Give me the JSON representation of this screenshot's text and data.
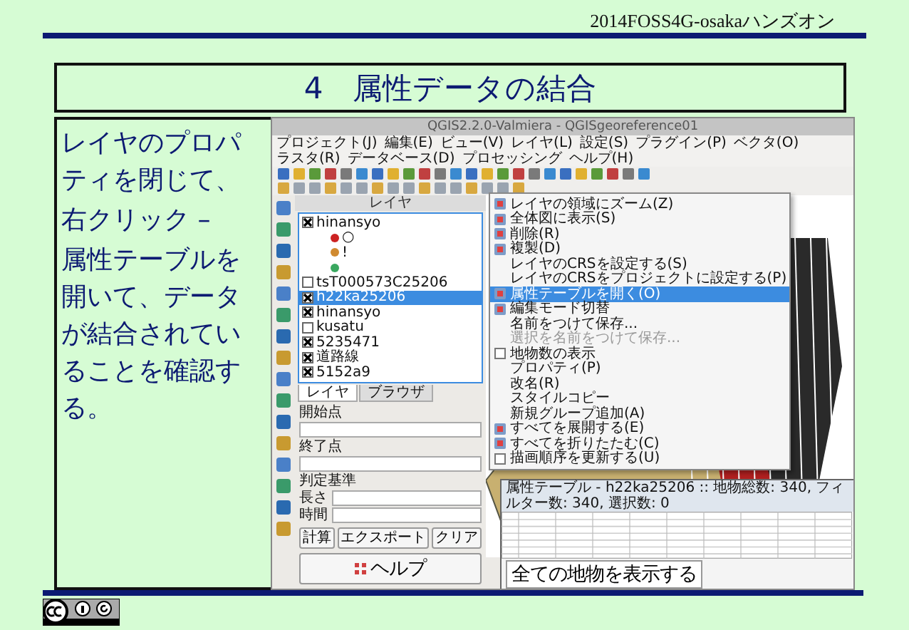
{
  "header": {
    "text": "2014FOSS4G-osakaハンズオン"
  },
  "slide_title": "4　属性データの結合",
  "note": {
    "paragraphs": [
      "レイヤのプロパティを閉じて、",
      "右クリック –",
      "属性テーブルを開いて、データが結合されていることを確認する。"
    ]
  },
  "qgis": {
    "window_title": "QGIS2.2.0-Valmiera - QGISgeoreference01",
    "menu": [
      "プロジェクト(J)",
      "編集(E)",
      "ビュー(V)",
      "レイヤ(L)",
      "設定(S)",
      "プラグイン(P)",
      "ベクタ(O)",
      "ラスタ(R)",
      "データベース(D)",
      "プロセッシング",
      "ヘルプ(H)"
    ],
    "layers_panel": {
      "title": "レイヤ",
      "layers": [
        {
          "name": "hinansyo",
          "checked": true,
          "selected": false,
          "children": [
            {
              "label": "○",
              "color": "#cc2222"
            },
            {
              "label": "!",
              "color": "#d08a30"
            },
            {
              "color": "#3aa860"
            }
          ]
        },
        {
          "name": "tsT000573C25206",
          "checked": false,
          "selected": false
        },
        {
          "name": "h22ka25206",
          "checked": true,
          "selected": true
        },
        {
          "name": "hinansyo",
          "checked": true,
          "selected": false
        },
        {
          "name": "kusatu",
          "checked": false,
          "selected": false
        },
        {
          "name": "5235471",
          "checked": true,
          "selected": false
        },
        {
          "name": "道路線",
          "checked": true,
          "selected": false
        },
        {
          "name": "5152a9",
          "checked": true,
          "selected": false
        }
      ]
    },
    "panel_tabs": [
      {
        "label": "レイヤ",
        "selected": true
      },
      {
        "label": "ブラウザ",
        "selected": false
      }
    ],
    "route_form": {
      "fields": [
        {
          "kind": "stacked",
          "label": "開始点"
        },
        {
          "kind": "stacked",
          "label": "終了点"
        },
        {
          "kind": "heading",
          "label": "判定基準"
        },
        {
          "kind": "inline",
          "label": "長さ"
        },
        {
          "kind": "inline",
          "label": "時間"
        }
      ],
      "buttons": [
        "計算",
        "エクスポート",
        "クリア"
      ],
      "help_button": "ヘルプ"
    },
    "context_menu": [
      {
        "label": "レイヤの領域にズーム(Z)",
        "kind": "icon",
        "selected": false,
        "disabled": false
      },
      {
        "label": "全体図に表示(S)",
        "kind": "icon",
        "selected": false,
        "disabled": false
      },
      {
        "label": "削除(R)",
        "kind": "icon",
        "selected": false,
        "disabled": false
      },
      {
        "label": "複製(D)",
        "kind": "icon",
        "selected": false,
        "disabled": false
      },
      {
        "label": "レイヤのCRSを設定する(S)",
        "kind": "plain",
        "selected": false,
        "disabled": false
      },
      {
        "label": "レイヤのCRSをプロジェクトに設定する(P)",
        "kind": "plain",
        "selected": false,
        "disabled": false
      },
      {
        "label": "属性テーブルを開く(O)",
        "kind": "icon",
        "selected": true,
        "disabled": false
      },
      {
        "label": "編集モード切替",
        "kind": "icon",
        "selected": false,
        "disabled": false
      },
      {
        "label": "名前をつけて保存...",
        "kind": "plain",
        "selected": false,
        "disabled": false
      },
      {
        "label": "選択を名前をつけて保存...",
        "kind": "plain",
        "selected": false,
        "disabled": true
      },
      {
        "label": "地物数の表示",
        "kind": "check",
        "selected": false,
        "disabled": false
      },
      {
        "label": "プロパティ(P)",
        "kind": "plain",
        "selected": false,
        "disabled": false
      },
      {
        "label": "改名(R)",
        "kind": "plain",
        "selected": false,
        "disabled": false
      },
      {
        "label": "スタイルコピー",
        "kind": "plain",
        "selected": false,
        "disabled": false
      },
      {
        "label": "新規グループ追加(A)",
        "kind": "plain",
        "selected": false,
        "disabled": false
      },
      {
        "label": "すべてを展開する(E)",
        "kind": "icon",
        "selected": false,
        "disabled": false
      },
      {
        "label": "すべてを折りたたむ(C)",
        "kind": "icon",
        "selected": false,
        "disabled": false
      },
      {
        "label": "描画順序を更新する(U)",
        "kind": "check",
        "selected": false,
        "disabled": false
      }
    ],
    "attribute_table": {
      "title": "属性テーブル - h22ka25206 :: 地物総数: 340, フィルター数: 340, 選択数: 0",
      "footer_button": "全ての地物を表示する"
    }
  }
}
